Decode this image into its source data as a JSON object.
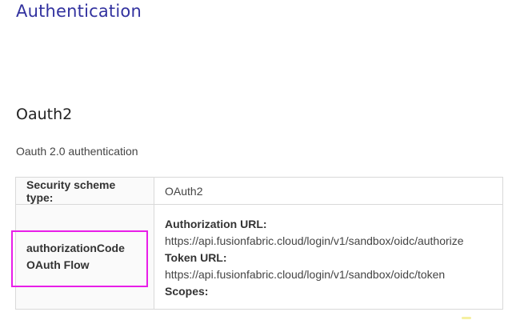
{
  "page": {
    "title": "Authentication"
  },
  "scheme": {
    "name": "Oauth2",
    "description": "Oauth 2.0 authentication"
  },
  "table": {
    "type_label": "Security scheme type:",
    "type_value": "OAuth2",
    "flow_label_line1": "authorizationCode",
    "flow_label_line2": "OAuth Flow",
    "authorization_url_label": "Authorization URL:",
    "authorization_url": "https://api.fusionfabric.cloud/login/v1/sandbox/oidc/authorize",
    "token_url_label": "Token URL:",
    "token_url": "https://api.fusionfabric.cloud/login/v1/sandbox/oidc/token",
    "scopes_label": "Scopes:"
  },
  "colors": {
    "title": "#32329f",
    "highlight": "#e81ee8",
    "border": "#d9d9d9"
  }
}
